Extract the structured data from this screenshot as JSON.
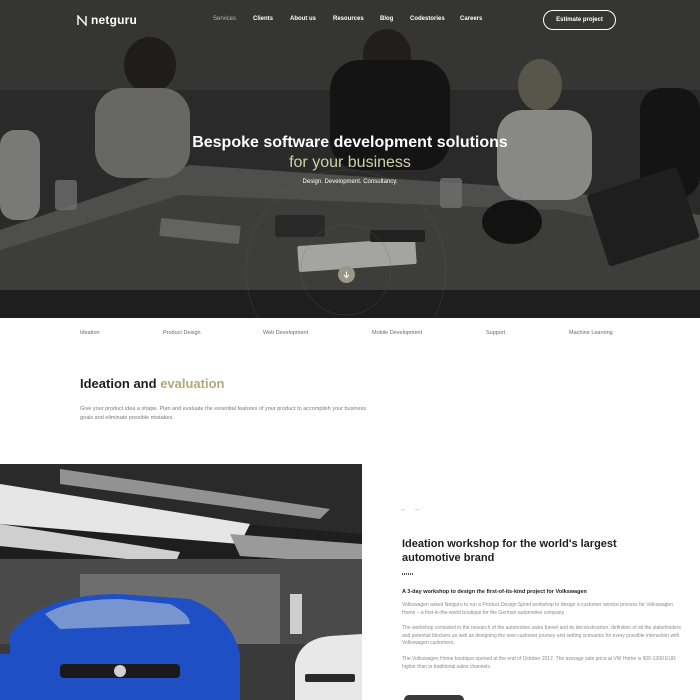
{
  "brand": {
    "name": "netguru",
    "accent": "#b4a97a",
    "hero_accent": "#d1d1a8"
  },
  "nav": {
    "items": [
      {
        "label": "Services",
        "active": true
      },
      {
        "label": "Clients",
        "active": false
      },
      {
        "label": "About us",
        "active": false
      },
      {
        "label": "Resources",
        "active": false
      },
      {
        "label": "Blog",
        "active": false
      },
      {
        "label": "Codestories",
        "active": false
      },
      {
        "label": "Careers",
        "active": false
      }
    ],
    "cta": "Estimate project"
  },
  "hero": {
    "title": "Bespoke software development solutions",
    "title_accent": "for your business",
    "subtitle": "Design. Development. Consultancy.",
    "scroll_icon": "arrow-down-icon"
  },
  "tabs": [
    "Ideation",
    "Product Design",
    "Web Development",
    "Mobile Development",
    "Support",
    "Machine Learning"
  ],
  "ideation": {
    "title_main": "Ideation and",
    "title_accent": "evaluation",
    "description": "Give your product idea a shape. Plan and evaluate the essential features of your product to accomplish your business goals and eliminate possible mistakes."
  },
  "case": {
    "arrows": "← →",
    "title": "Ideation workshop for the world's largest automotive brand",
    "subtitle": "A 3-day workshop to design the first-of-its-kind project for Volkswagen",
    "paragraphs": [
      "Volkswagen asked Netguru to run a Product Design Sprint workshop to design a customer service process for Volkswagen Home – a first-in-the-world boutique for the German automotive company.",
      "The workshop consisted in the research of the automotive sales funnel and its deconstruction, definition of all the stakeholders and potential blockers as well as designing the new customer journey and setting scenarios for every possible interaction with Volkswagen customers.",
      "The Volkswagen Home boutique opened at the end of October 2017. The average sale price at VW Home is 900-1200 EUR higher than in traditional sales channels."
    ]
  }
}
